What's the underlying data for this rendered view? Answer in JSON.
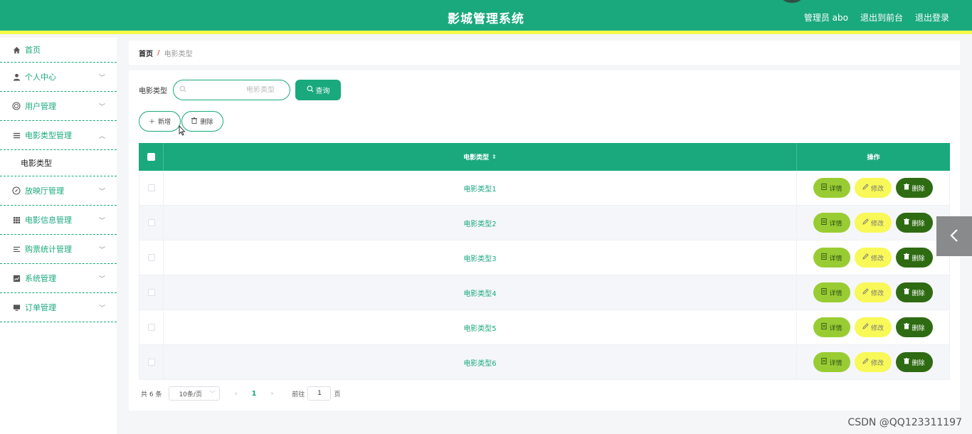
{
  "header": {
    "title": "影城管理系统",
    "admin": "管理员 abo",
    "back_to_front": "退出到前台",
    "logout": "退出登录"
  },
  "sidebar": {
    "items": [
      {
        "label": "首页",
        "icon": "home-icon"
      },
      {
        "label": "个人中心",
        "icon": "user-icon"
      },
      {
        "label": "用户管理",
        "icon": "globe-icon"
      },
      {
        "label": "电影类型管理",
        "icon": "list-icon"
      },
      {
        "label": "放映厅管理",
        "icon": "compass-icon"
      },
      {
        "label": "电影信息管理",
        "icon": "grid-icon"
      },
      {
        "label": "购票统计管理",
        "icon": "list-icon"
      },
      {
        "label": "系统管理",
        "icon": "chart-icon"
      },
      {
        "label": "订单管理",
        "icon": "monitor-icon"
      }
    ],
    "submenu_label": "电影类型"
  },
  "breadcrumb": {
    "home": "首页",
    "separator": "/",
    "current": "电影类型"
  },
  "search": {
    "label": "电影类型",
    "placeholder": "电影类型",
    "button": "查询"
  },
  "actions": {
    "add": "新增",
    "delete": "删除"
  },
  "table": {
    "columns": [
      "电影类型",
      "操作"
    ],
    "rows": [
      "电影类型1",
      "电影类型2",
      "电影类型3",
      "电影类型4",
      "电影类型5",
      "电影类型6"
    ],
    "row_buttons": {
      "detail": "详情",
      "edit": "修改",
      "delete": "删除"
    }
  },
  "pagination": {
    "total": "共 6 条",
    "page_size": "10条/页",
    "current_page": "1",
    "goto_prefix": "前往",
    "goto_value": "1",
    "goto_suffix": "页"
  },
  "watermark": "CSDN @QQ123311197",
  "colors": {
    "primary": "#1aa97c",
    "accent_bar": "#f5f94c",
    "detail_btn": "#99cc33",
    "edit_btn": "#f8f858",
    "delete_btn": "#2e6b12"
  }
}
